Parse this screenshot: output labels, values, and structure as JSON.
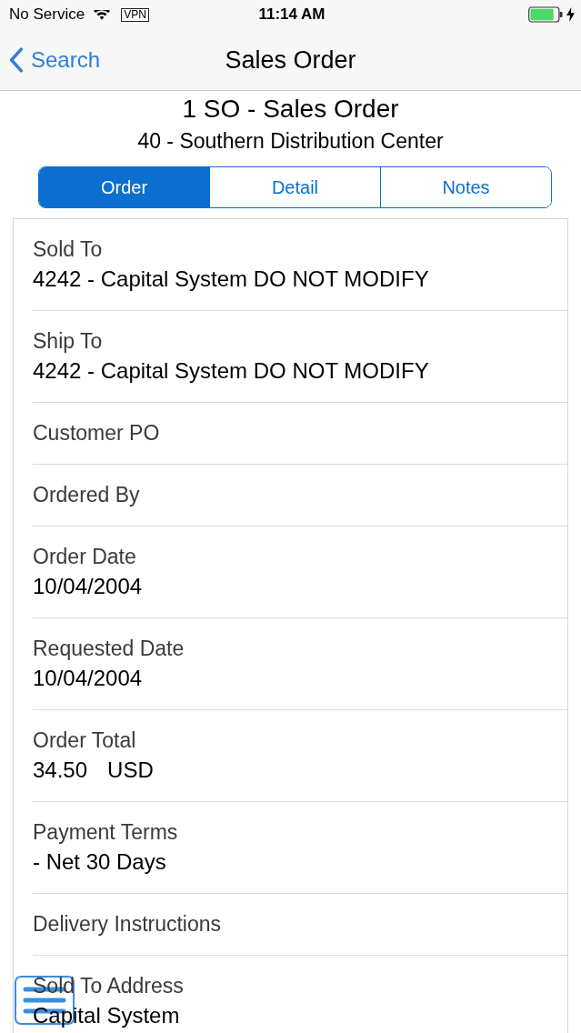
{
  "status_bar": {
    "carrier": "No Service",
    "vpn": "VPN",
    "time": "11:14 AM"
  },
  "nav_bar": {
    "back": "Search",
    "title": "Sales Order"
  },
  "header": {
    "title": "1 SO - Sales Order",
    "subtitle": "40 - Southern Distribution Center"
  },
  "tabs": [
    {
      "label": "Order",
      "selected": true
    },
    {
      "label": "Detail",
      "selected": false
    },
    {
      "label": "Notes",
      "selected": false
    }
  ],
  "fields": [
    {
      "label": "Sold To",
      "value": "4242 - Capital System DO NOT MODIFY"
    },
    {
      "label": "Ship To",
      "value": "4242 - Capital System DO NOT MODIFY"
    },
    {
      "label": "Customer PO"
    },
    {
      "label": "Ordered By"
    },
    {
      "label": "Order Date",
      "value": "10/04/2004"
    },
    {
      "label": "Requested Date",
      "value": "10/04/2004"
    },
    {
      "label": "Order Total",
      "value": "34.50",
      "currency": "USD"
    },
    {
      "label": "Payment Terms",
      "value": "- Net 30 Days"
    },
    {
      "label": "Delivery Instructions"
    },
    {
      "label": "Sold To Address",
      "value": "Capital System"
    }
  ]
}
